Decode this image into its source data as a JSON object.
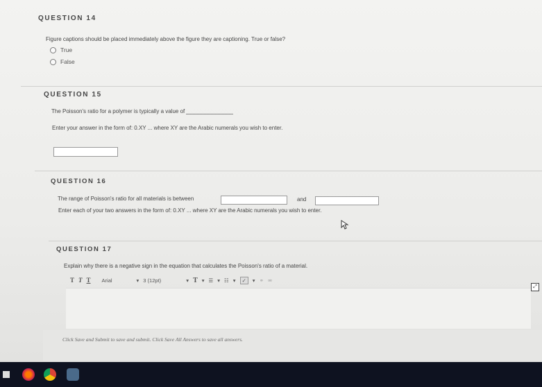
{
  "q14": {
    "title": "QUESTION 14",
    "prompt": "Figure captions should be placed immediately above the figure they are captioning. True or false?",
    "options": [
      "True",
      "False"
    ]
  },
  "q15": {
    "title": "QUESTION 15",
    "prompt": "The Poisson's ratio for a polymer is typically a value of",
    "instruction": "Enter your answer in the form of: 0.XY ... where XY are the Arabic numerals you wish to enter."
  },
  "q16": {
    "title": "QUESTION 16",
    "prompt": "The range of Poisson's ratio for all materials is between",
    "and_label": "and",
    "instruction": "Enter each of your two answers in the form of: 0.XY ... where XY are the Arabic numerals you wish to enter."
  },
  "q17": {
    "title": "QUESTION 17",
    "prompt": "Explain why there is a negative sign in the equation that calculates the Poisson's ratio of a material.",
    "toolbar": {
      "font": "Arial",
      "size": "3 (12pt)"
    }
  },
  "footer": {
    "submit_text": "Click Save and Submit to save and submit. Click Save All Answers to save all answers."
  },
  "colors": {
    "taskbar": "#0e1220",
    "page_bg": "#efefed"
  }
}
